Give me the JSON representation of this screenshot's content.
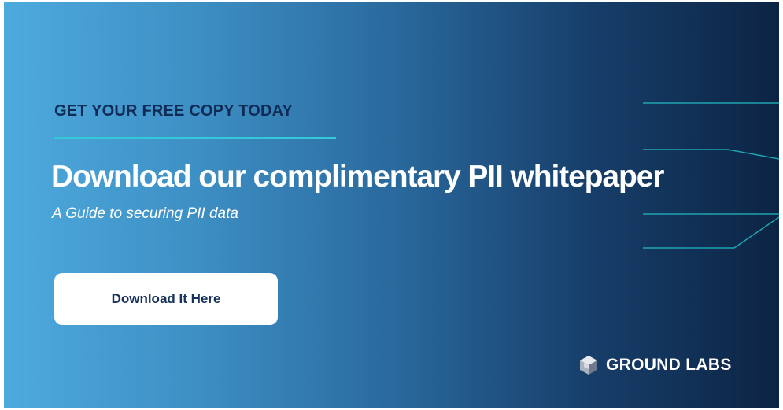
{
  "banner": {
    "eyebrow": "GET YOUR FREE COPY TODAY",
    "headline": "Download our complimentary PII whitepaper",
    "subheadline": "A Guide to securing PII data",
    "cta_label": "Download It Here",
    "brand_name": "GROUND LABS"
  },
  "colors": {
    "gradient_start": "#4eaadd",
    "gradient_end": "#0c2444",
    "accent_line": "#34c8d8",
    "eyebrow_text": "#0f2b55",
    "cta_text": "#15315c"
  },
  "icons": {
    "brand_logo": "ground-labs-logo-icon",
    "decoration": "circuit-lines-decoration"
  }
}
